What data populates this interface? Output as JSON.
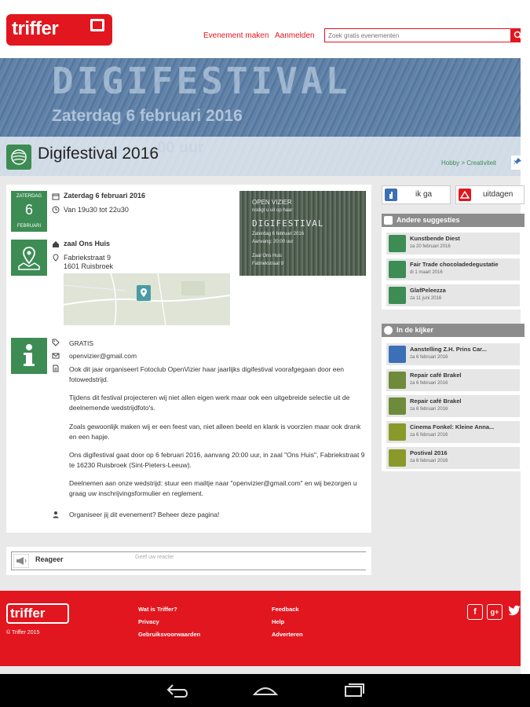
{
  "header": {
    "logo_text": "triffer",
    "links": [
      "Evenement maken",
      "Aanmelden"
    ],
    "search_placeholder": "Zoek gratis evenementen"
  },
  "banner": {
    "title_art": "DIGIFESTIVAL",
    "date_art": "Zaterdag 6 februari 2016",
    "time_art": "00 uur"
  },
  "event": {
    "title": "Digifestival 2016",
    "breadcrumb": "Hobby > Creativiteit",
    "calendar": {
      "top": "ZATERDAG",
      "day": "6",
      "month": "FEBRUARI"
    },
    "date": "Zaterdag 6 februari 2016",
    "time": "Van 19u30 tot 22u30",
    "venue": "zaal Ons Huis",
    "address1": "Fabriekstraat 9",
    "address2": "1601 Ruisbroek",
    "price": "GRATIS",
    "email": "openvizier@gmail.com",
    "description": [
      "Ook dit jaar organiseert Fotoclub OpenVizier haar jaarlijks digifestival voorafgegaan door een fotowedstrijd.",
      "Tijdens dit festival projecteren wij niet allen eigen werk maar ook een uitgebreide selectie uit de deelnemende wedstrijdfoto's.",
      "Zoals gewoonlijk maken wij er een feest van, niet alleen beeld en klank is voorzien maar ook drank en een hapje.",
      "Ons digifestival gaat door op 6 februari 2016, aanvang 20:00 uur, in zaal \"Ons Huis\", Fabriekstraat 9 te 16230 Ruisbroek (Sint-Pieters-Leeuw).",
      "Deelnemen aan onze wedstrijd: stuur een mailtje naar \"openvizier@gmail.com\" en wij bezorgen u graag uw inschrijvingsformulier en reglement."
    ],
    "organizer_note": "Organiseer jij dit evenement? Beheer deze pagina!",
    "poster": {
      "line1": "OPEN VIZIER",
      "line2": "nodigt u uit op haar",
      "line3": "DIGIFESTIVAL",
      "line4": "Zaterdag 6 februari 2016",
      "line5": "Aanvang: 20:00 uur",
      "line6": "Zaal Ons Huis",
      "line7": "Fabriekstraat 9"
    }
  },
  "react": {
    "label": "Reageer",
    "placeholder": "Geef uw reactie"
  },
  "actions": {
    "go": "ik ga",
    "challenge": "uitdagen"
  },
  "suggestions": {
    "title": "Andere suggesties",
    "items": [
      {
        "name": "Kunstbende Diest",
        "date": "za 20 februari 2016"
      },
      {
        "name": "Fair Trade chocoladedegustatie",
        "date": "di 1 maart 2016"
      },
      {
        "name": "GlafPeleezza",
        "date": "za 11 juni 2016"
      }
    ]
  },
  "watch": {
    "title": "In de kijker",
    "items": [
      {
        "name": "Aanstelling Z.H. Prins Car...",
        "date": "za 6 februari 2016"
      },
      {
        "name": "Repair café Brakel",
        "date": "za 6 februari 2016"
      },
      {
        "name": "Repair café Brakel",
        "date": "za 6 februari 2016"
      },
      {
        "name": "Cinema Fonkel: Kleine Anna...",
        "date": "za 6 februari 2016"
      },
      {
        "name": "Postival 2016",
        "date": "za 6 februari 2016"
      }
    ]
  },
  "footer": {
    "logo_text": "triffer",
    "copyright": "© Triffer 2015",
    "col1": [
      "Wat is Triffer?",
      "Privacy",
      "Gebruiksvoorwaarden"
    ],
    "col2": [
      "Feedback",
      "Help",
      "Adverteren"
    ],
    "social": [
      "f",
      "g+"
    ]
  },
  "colors": {
    "brand_red": "#e2161e",
    "green": "#3d8c54",
    "panel_header": "#8c8c8c"
  }
}
